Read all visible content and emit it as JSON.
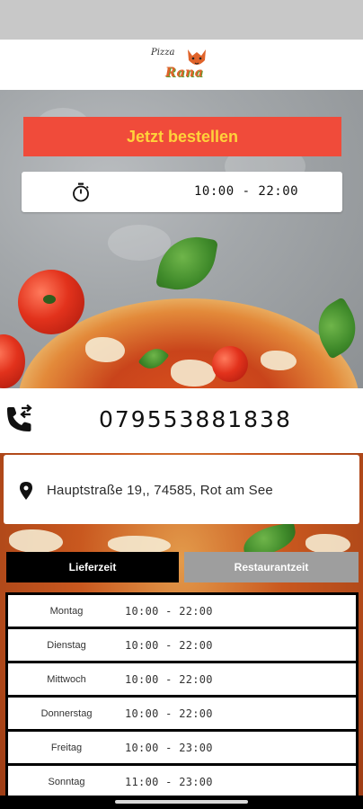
{
  "header": {
    "logo_small": "Pizza",
    "logo_big": "Rana"
  },
  "order": {
    "button_label": "Jetzt bestellen"
  },
  "hours_card": {
    "icon": "stopwatch-icon",
    "hours": "10:00 - 22:00"
  },
  "phone": {
    "icon": "phone-forward-icon",
    "number": "079553881838"
  },
  "address": {
    "icon": "map-pin-icon",
    "text": "Hauptstraße 19,, 74585, Rot am See"
  },
  "tabs": {
    "delivery": "Lieferzeit",
    "restaurant": "Restaurantzeit"
  },
  "schedule": [
    {
      "day": "Montag",
      "hours": "10:00 - 22:00"
    },
    {
      "day": "Dienstag",
      "hours": "10:00 - 22:00"
    },
    {
      "day": "Mittwoch",
      "hours": "10:00 - 22:00"
    },
    {
      "day": "Donnerstag",
      "hours": "10:00 - 22:00"
    },
    {
      "day": "Freitag",
      "hours": "10:00 - 23:00"
    },
    {
      "day": "Sonntag",
      "hours": "11:00 - 23:00"
    }
  ],
  "colors": {
    "order_button": "#f04b3a",
    "order_text": "#ffd23a",
    "active_tab": "#000000",
    "inactive_tab": "#9e9e9e"
  }
}
